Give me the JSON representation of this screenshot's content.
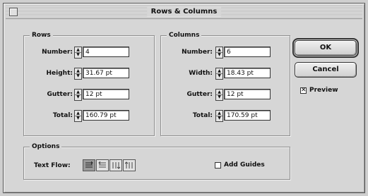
{
  "dialog": {
    "title": "Rows & Columns"
  },
  "rows": {
    "label": "Rows",
    "number": {
      "label": "Number:",
      "value": "4"
    },
    "height": {
      "label": "Height:",
      "value": "31.67 pt"
    },
    "gutter": {
      "label": "Gutter:",
      "value": "12 pt"
    },
    "total": {
      "label": "Total:",
      "value": "160.79 pt"
    }
  },
  "columns": {
    "label": "Columns",
    "number": {
      "label": "Number:",
      "value": "6"
    },
    "width": {
      "label": "Width:",
      "value": "18.43 pt"
    },
    "gutter": {
      "label": "Gutter:",
      "value": "12 pt"
    },
    "total": {
      "label": "Total:",
      "value": "170.59 pt"
    }
  },
  "options": {
    "label": "Options",
    "text_flow_label": "Text Flow:",
    "add_guides_label": "Add Guides",
    "add_guides_checked": false
  },
  "buttons": {
    "ok": "OK",
    "cancel": "Cancel"
  },
  "preview": {
    "label": "Preview",
    "checked": true,
    "check_glyph": "✕"
  }
}
